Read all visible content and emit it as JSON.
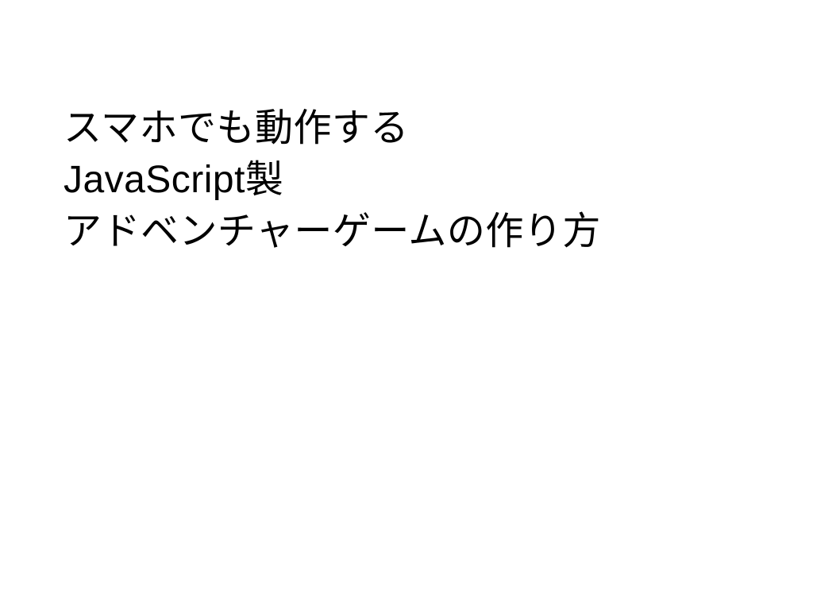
{
  "slide": {
    "title": {
      "line1": "スマホでも動作する",
      "line2": "JavaScript製",
      "line3": "アドベンチャーゲームの作り方"
    }
  }
}
